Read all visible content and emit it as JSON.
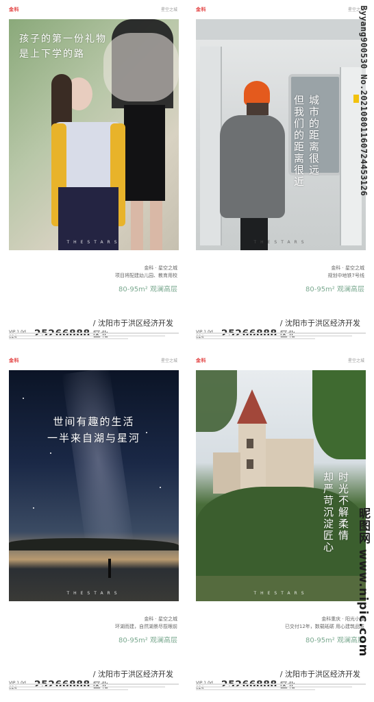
{
  "brand_logo": "金科",
  "brand_right": "星空之城",
  "project_tag": "THESTARS",
  "posters": [
    {
      "headline": [
        "孩子的第一份礼物",
        "是上下学的路"
      ],
      "info_line1": "金科 · 星空之城",
      "info_line2": "项目将配建幼儿园、教育用校",
      "area": "80-95m² 观澜高层",
      "phone_prefix": "VIP 1 0d 024",
      "phone": "25266888",
      "address": "/ 沈阳市于洪区经济开发区北"
    },
    {
      "headline_vertical": [
        "城市的距离很远",
        "但我们的距离很近"
      ],
      "info_line1": "金科 · 星空之城",
      "info_line2": "规划中地铁7号线",
      "area": "80-95m² 观澜高层",
      "phone_prefix": "VIP 1 0d 024",
      "phone": "25266888",
      "address": "/ 沈阳市于洪区经济开发区北"
    },
    {
      "headline": [
        "世间有趣的生活",
        "一半来自湖与星河"
      ],
      "info_line1": "金科 · 星空之城",
      "info_line2": "环湖而建，自然湖景尽揽眼前",
      "area": "80-95m² 观澜高层",
      "phone_prefix": "VIP 1 0d 024",
      "phone": "25266888",
      "address": "/ 沈阳市于洪区经济开发区北"
    },
    {
      "headline_vertical": [
        "时光不解柔情",
        "却严苛沉淀匠心"
      ],
      "info_line1": "金科重庆 · 阳光小镇",
      "info_line2": "已交付12年，数载砥砺 用心建筑品质",
      "area": "80-95m² 观澜高层",
      "phone_prefix": "VIP 1 0d 024",
      "phone": "25266888",
      "address": "/ 沈阳市于洪区经济开发区北"
    }
  ],
  "watermark_side": "Byyang900530 No.20210801160724453126",
  "watermark_bottom": "昵图网 www.nipic.com"
}
